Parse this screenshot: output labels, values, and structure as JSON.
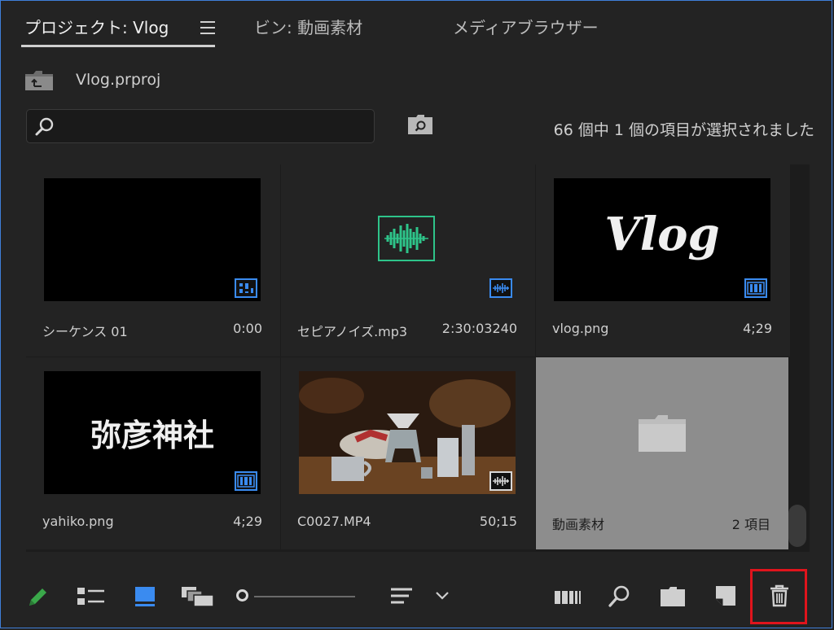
{
  "tabs": [
    {
      "label": "プロジェクト: Vlog",
      "active": true
    },
    {
      "label": "ビン: 動画素材",
      "active": false
    },
    {
      "label": "メディアブラウザー",
      "active": false
    }
  ],
  "project": {
    "file_name": "Vlog.prproj"
  },
  "search": {
    "value": "",
    "placeholder": ""
  },
  "status_text": "66 個中 1 個の項目が選択されました",
  "items": [
    {
      "name": "シーケンス 01",
      "duration": "0:00",
      "thumbnail": "black",
      "badge": "sequence-icon"
    },
    {
      "name": "セピアノイズ.mp3",
      "duration": "2:30:03240",
      "thumbnail": "audio-waveform",
      "badge": "audio-icon"
    },
    {
      "name": "vlog.png",
      "duration": "4;29",
      "thumbnail": "Vlog",
      "badge": "film-icon"
    },
    {
      "name": "yahiko.png",
      "duration": "4;29",
      "thumbnail": "弥彦神社",
      "badge": "film-icon"
    },
    {
      "name": "C0027.MP4",
      "duration": "50;15",
      "thumbnail": "coffee-photo",
      "badge": "audio-icon"
    },
    {
      "name": "動画素材",
      "duration": "2 項目",
      "thumbnail": "folder-icon",
      "selected": true
    }
  ],
  "toolbar": {
    "icons": [
      "pencil-icon",
      "list-view-icon",
      "icon-view-icon",
      "freeform-view-icon",
      "zoom-slider",
      "sort-icon",
      "chevron-down-icon",
      "automate-to-sequence-icon",
      "find-icon",
      "new-bin-icon",
      "new-item-icon",
      "trash-icon"
    ],
    "highlighted": "trash-icon"
  },
  "colors": {
    "accent": "#3a8bf0",
    "highlight": "#e0141c",
    "waveform": "#2ec48a",
    "pencil": "#3aa84a"
  }
}
